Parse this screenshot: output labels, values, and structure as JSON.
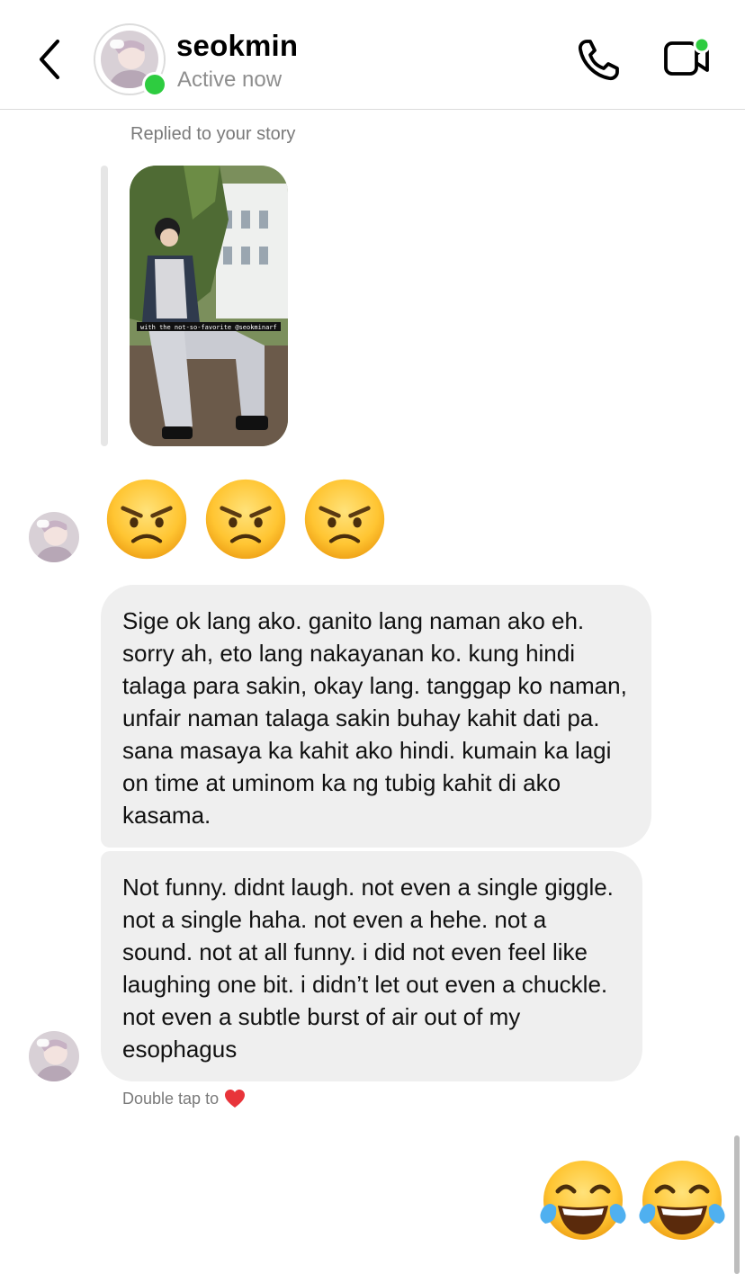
{
  "header": {
    "name": "seokmin",
    "status": "Active now"
  },
  "story_reply": {
    "label": "Replied to your story",
    "story_caption": "with the not-so-favorite @seokminarf"
  },
  "messages": [
    {
      "from": "them",
      "type": "emoji",
      "emojis": [
        "angry-face",
        "angry-face",
        "angry-face"
      ]
    },
    {
      "from": "them",
      "type": "text",
      "text": "Sige ok lang ako. ganito lang naman ako eh. sorry ah, eto lang nakayanan ko. kung hindi talaga para sakin, okay lang. tanggap ko naman, unfair naman talaga sakin buhay kahit dati pa. sana masaya ka kahit ako hindi. kumain ka lagi on time at uminom ka ng tubig kahit di ako kasama."
    },
    {
      "from": "them",
      "type": "text",
      "text": "Not funny. didnt laugh. not even a single giggle. not a single haha. not even a hehe. not a sound. not at all funny. i did not even feel like laughing one bit. i didn’t let out even a chuckle. not even a subtle burst of air out of my esophagus"
    },
    {
      "from": "me",
      "type": "emoji",
      "emojis": [
        "face-with-tears-of-joy",
        "face-with-tears-of-joy"
      ]
    }
  ],
  "hint": {
    "text": "Double tap to",
    "icon": "red-heart"
  },
  "colors": {
    "online": "#2ecc40",
    "bubble": "#efefef",
    "secondary_text": "#8e8e8e"
  }
}
